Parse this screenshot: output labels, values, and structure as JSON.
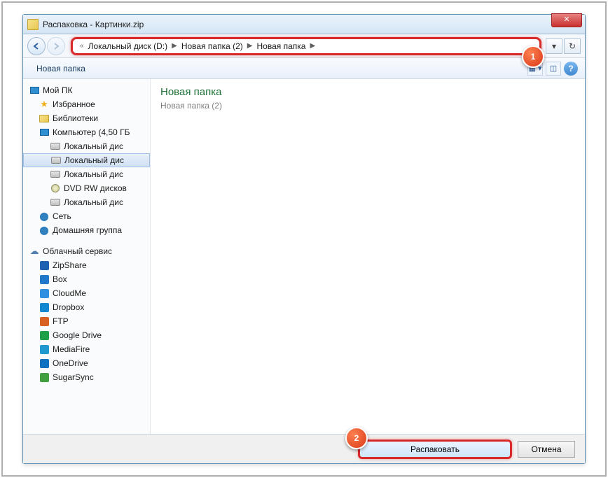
{
  "window": {
    "title": "Распаковка - Картинки.zip"
  },
  "breadcrumb": {
    "prefix": "«",
    "items": [
      "Локальный диск (D:)",
      "Новая папка (2)",
      "Новая папка"
    ]
  },
  "toolbar": {
    "new_folder": "Новая папка"
  },
  "sidebar": {
    "groups": [
      {
        "items": [
          {
            "label": "Мой ПК",
            "icon": "pc",
            "indent": 0
          },
          {
            "label": "Избранное",
            "icon": "star",
            "indent": 1
          },
          {
            "label": "Библиотеки",
            "icon": "folder",
            "indent": 1
          },
          {
            "label": "Компьютер (4,50 ГБ",
            "icon": "pc",
            "indent": 1
          },
          {
            "label": "Локальный дис",
            "icon": "drive",
            "indent": 2
          },
          {
            "label": "Локальный дис",
            "icon": "drive",
            "indent": 2,
            "selected": true
          },
          {
            "label": "Локальный дис",
            "icon": "drive",
            "indent": 2
          },
          {
            "label": "DVD RW дисков",
            "icon": "dvd",
            "indent": 2
          },
          {
            "label": "Локальный дис",
            "icon": "drive",
            "indent": 2
          },
          {
            "label": "Сеть",
            "icon": "net",
            "indent": 1
          },
          {
            "label": "Домашняя группа",
            "icon": "net",
            "indent": 1
          }
        ]
      },
      {
        "items": [
          {
            "label": "Облачный сервис",
            "icon": "cloud",
            "indent": 0
          },
          {
            "label": "ZipShare",
            "icon": "generic",
            "color": "#2060b0",
            "indent": 1
          },
          {
            "label": "Box",
            "icon": "generic",
            "color": "#2078c8",
            "indent": 1
          },
          {
            "label": "CloudMe",
            "icon": "generic",
            "color": "#3090e0",
            "indent": 1
          },
          {
            "label": "Dropbox",
            "icon": "generic",
            "color": "#1088d0",
            "indent": 1
          },
          {
            "label": "FTP",
            "icon": "generic",
            "color": "#d86020",
            "indent": 1
          },
          {
            "label": "Google Drive",
            "icon": "generic",
            "color": "#20a048",
            "indent": 1
          },
          {
            "label": "MediaFire",
            "icon": "generic",
            "color": "#2098d0",
            "indent": 1
          },
          {
            "label": "OneDrive",
            "icon": "generic",
            "color": "#1070c0",
            "indent": 1
          },
          {
            "label": "SugarSync",
            "icon": "generic",
            "color": "#40a040",
            "indent": 1
          }
        ]
      }
    ]
  },
  "content": {
    "title": "Новая папка",
    "subtitle": "Новая папка (2)"
  },
  "footer": {
    "primary": "Распаковать",
    "cancel": "Отмена"
  },
  "callouts": {
    "one": "1",
    "two": "2"
  }
}
